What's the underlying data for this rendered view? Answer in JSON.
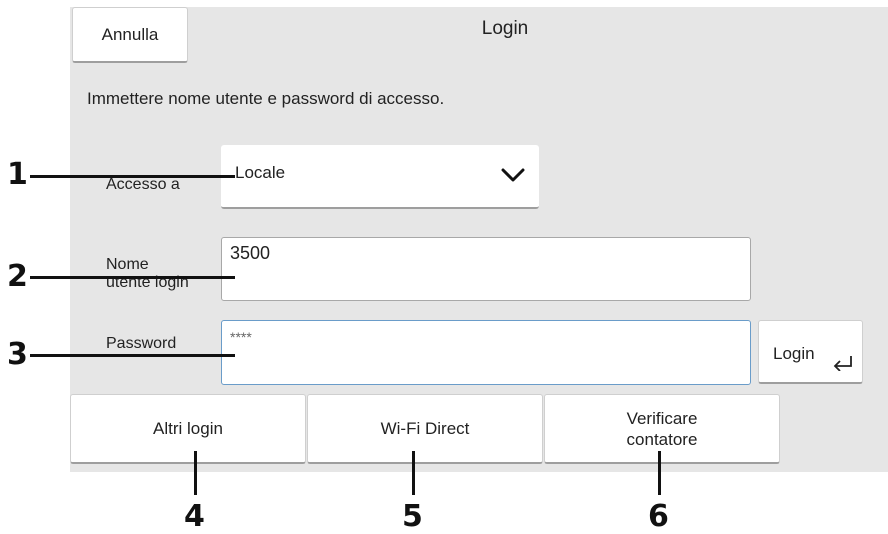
{
  "header": {
    "cancel_label": "Annulla",
    "title": "Login"
  },
  "instruction": "Immettere nome utente e password di accesso.",
  "access": {
    "label": "Accesso a",
    "selected": "Locale",
    "icon": "chevron-down-icon"
  },
  "username": {
    "label_line1": "Nome",
    "label_line2": "utente login",
    "value": "3500"
  },
  "password": {
    "label": "Password",
    "value": "****"
  },
  "login_button": {
    "label": "Login",
    "icon": "enter-return-icon"
  },
  "bottom_buttons": {
    "other_login": "Altri login",
    "wifi_direct": "Wi-Fi Direct",
    "check_counter_line1": "Verificare",
    "check_counter_line2": "contatore"
  },
  "callouts": [
    "1",
    "2",
    "3",
    "4",
    "5",
    "6"
  ],
  "colors": {
    "panel_bg": "#e6e6e6",
    "focus_border": "#6a9cc9"
  }
}
